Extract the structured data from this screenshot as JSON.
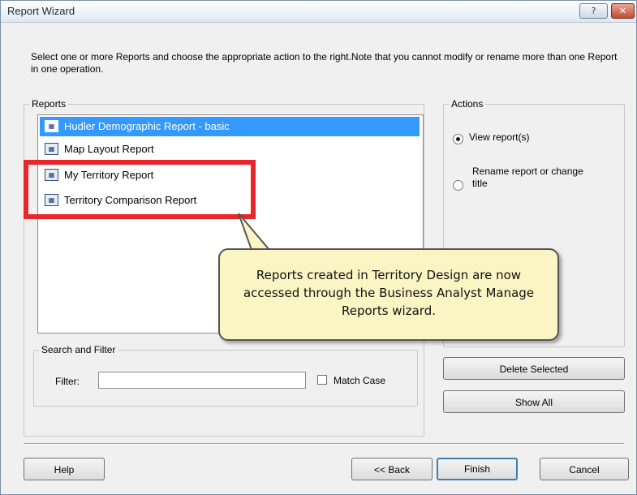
{
  "window": {
    "title": "Report Wizard",
    "help_button": "?",
    "close_button": "✕"
  },
  "instructions": "Select one or more Reports and choose the appropriate action to the right.Note that you cannot modify or rename more than one Report in one operation.",
  "reports": {
    "group_label": "Reports",
    "items": [
      {
        "label": "Hudler Demographic Report - basic",
        "selected": true
      },
      {
        "label": "Map Layout Report",
        "selected": false
      },
      {
        "label": "My Territory Report",
        "selected": false
      },
      {
        "label": "Territory Comparison Report",
        "selected": false
      }
    ]
  },
  "actions": {
    "group_label": "Actions",
    "view_label": "View report(s)",
    "rename_label": "Rename report or change title",
    "selected": "view"
  },
  "search": {
    "group_label": "Search and Filter",
    "filter_label": "Filter:",
    "filter_value": "",
    "match_case_label": "Match Case",
    "match_case_checked": false
  },
  "buttons": {
    "delete_selected": "Delete Selected",
    "show_all": "Show All",
    "help": "Help",
    "back": "<< Back",
    "finish": "Finish",
    "cancel": "Cancel"
  },
  "callout": {
    "text": "Reports created in Territory Design are now accessed through the Business Analyst Manage Reports wizard."
  },
  "colors": {
    "selection": "#3399ff",
    "highlight": "#e8262c",
    "callout_bg": "#fbf5c4"
  }
}
